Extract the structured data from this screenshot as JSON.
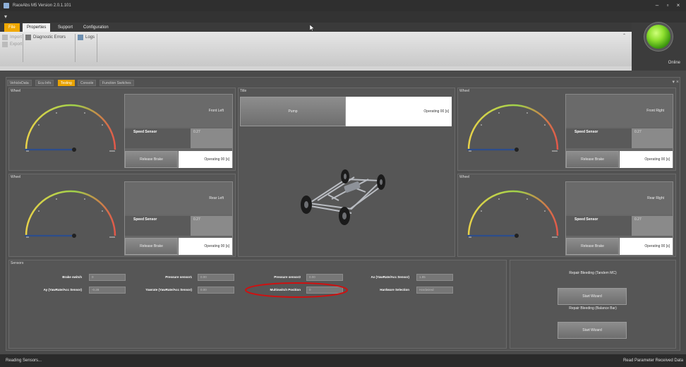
{
  "window": {
    "title": "RaceAbs M5 Version 2.0.1.101",
    "controls": [
      "–",
      "▫",
      "×"
    ]
  },
  "qat": {
    "glyph": "▾"
  },
  "ribbon": {
    "tabs": [
      "File",
      "Properties",
      "Support",
      "Configuration"
    ],
    "collapse": "⌃",
    "buttons": {
      "import": "Import",
      "diagnostic_errors": "Diagnostic Errors",
      "logs": "Logs",
      "export": "Export"
    }
  },
  "status_indicator": {
    "label": "Online",
    "color": "#7dd321"
  },
  "content": {
    "tabs": [
      "VehicleData",
      "Ecu Info",
      "Testing",
      "Console",
      "Function Switches"
    ],
    "active_tab": "Testing",
    "close": "▾ ×"
  },
  "wheels": {
    "front_left": {
      "group_label": "Wheel",
      "title": "Front Left",
      "speed_sensor_label": "Speed Sensor",
      "speed_sensor_value": "0.27",
      "release_brake_label": "Release Brake",
      "status": "Operating 00 [s]"
    },
    "rear_left": {
      "group_label": "Wheel",
      "title": "Rear Left",
      "speed_sensor_label": "Speed Sensor",
      "speed_sensor_value": "0.27",
      "release_brake_label": "Release Brake",
      "status": "Operating 00 [s]"
    },
    "front_right": {
      "group_label": "Wheel",
      "title": "Front Right",
      "speed_sensor_label": "Speed Sensor",
      "speed_sensor_value": "0.27",
      "release_brake_label": "Release Brake",
      "status": "Operating 00 [s]"
    },
    "rear_right": {
      "group_label": "Wheel",
      "title": "Rear Right",
      "speed_sensor_label": "Speed Sensor",
      "speed_sensor_value": "0.27",
      "release_brake_label": "Release Brake",
      "status": "Operating 00 [s]"
    }
  },
  "pump": {
    "group_label": "Title",
    "button_label": "Pump",
    "status": "Operating 00 [s]"
  },
  "sensors": {
    "group_label": "Sensors",
    "fields": [
      {
        "label": "Brake switch",
        "value": "0"
      },
      {
        "label": "Pressure sensor1",
        "value": "0.00"
      },
      {
        "label": "Pressure sensor2",
        "value": "0.00"
      },
      {
        "label": "Ax (YawRate/Acc Sensor)",
        "value": "1.85"
      },
      {
        "label": "Ay (YawRate/Acc Sensor)",
        "value": "-0.28"
      },
      {
        "label": "Yawrate (YawRate/Acc Sensor)",
        "value": "0.00"
      },
      {
        "label": "Multiswitch Position",
        "value": "0"
      },
      {
        "label": "Hardware Selection",
        "value": "Hardwired"
      }
    ]
  },
  "bleeding": {
    "tandem_label": "Repair Bleeding (Tandem MC)",
    "tandem_button": "Start Wizard",
    "balance_label": "Repair Bleeding (Balance Bar)",
    "balance_button": "Start Wizard"
  },
  "statusbar": {
    "left": "Reading Sensors...",
    "right": "Read Parameter Received Data"
  },
  "highlight": {
    "color": "#d01010"
  }
}
